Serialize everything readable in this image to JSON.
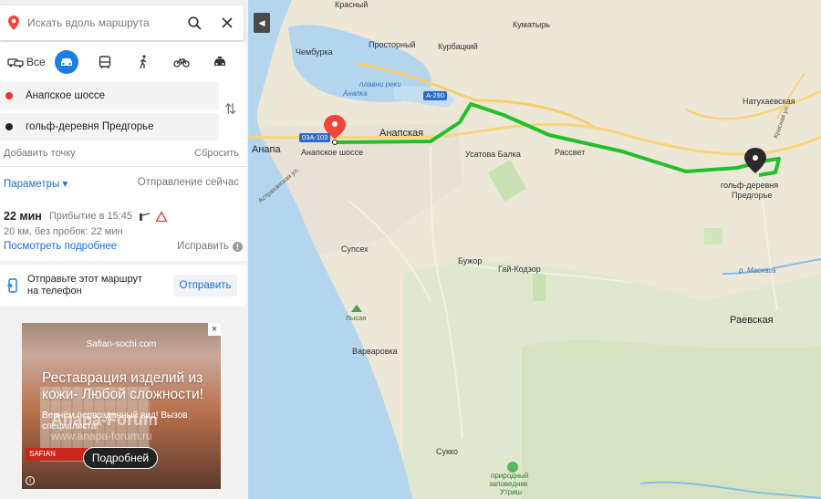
{
  "search": {
    "placeholder": "Искать вдоль маршрута"
  },
  "modes": {
    "all_label": "Все"
  },
  "route_points": {
    "from": "Анапское шоссе",
    "to": "гольф-деревня Предгорье"
  },
  "actions": {
    "add_point": "Добавить точку",
    "reset": "Сбросить"
  },
  "params": {
    "label": "Параметры ▾",
    "departure": "Отправление сейчас"
  },
  "route": {
    "duration": "22 мин",
    "arrival": "Прибытие в 15:45",
    "summary": "20 км, без пробок: 22 мин",
    "details_link": "Посмотреть подробнее",
    "fix_label": "Исправить"
  },
  "send": {
    "text_line1": "Отправьте этот маршрут",
    "text_line2": "на телефон",
    "button": "Отправить"
  },
  "ad": {
    "domain": "Safian-sochi.com",
    "headline": "Реставрация изделий из кожи- Любой сложности!",
    "subtext": "Вернём первозданный вид! Вызов специалиста!",
    "button": "Подробней",
    "sign": "SAFIAN"
  },
  "watermark": {
    "line1": "Anapa-Forum",
    "line2": "www.anapa-forum.ru"
  },
  "map": {
    "labels": {
      "krasny": "Красный",
      "chemburka": "Чембурка",
      "prostorny": "Просторный",
      "kurbatsky": "Курбацкий",
      "kumatyr": "Куматырь",
      "plavni": "плавни реки",
      "anapka": "Анапка",
      "a290": "А-290",
      "anapa": "Анапа",
      "route_start": "Анапское шоссе",
      "anapskaya": "Анапская",
      "ustatova": "Усатова Балка",
      "rassvet": "Рассвет",
      "natukhaevskaya": "Натухаевская",
      "dest_line1": "гольф-деревня",
      "dest_line2": "Предгорье",
      "supseh": "Супсех",
      "buzhor": "Бужор",
      "gaykodzor": "Гай-Кодзор",
      "lysaya": "Лысая",
      "varvarovka": "Варваровка",
      "raevskaya": "Раевская",
      "sukko": "Сукко",
      "reserve1": "природный",
      "reserve2": "заповедник",
      "reserve3": "Утриш",
      "maskaga": "р. Маскага",
      "astrakhan": "Астраханская ул.",
      "shield_03a": "03А-103",
      "krasnaya": "Красная ул."
    }
  },
  "colors": {
    "route": "#22c02a",
    "accent": "#1c7ee3",
    "start_marker": "#f0453a",
    "water": "#b3d6ee",
    "land": "#ece7d7"
  }
}
